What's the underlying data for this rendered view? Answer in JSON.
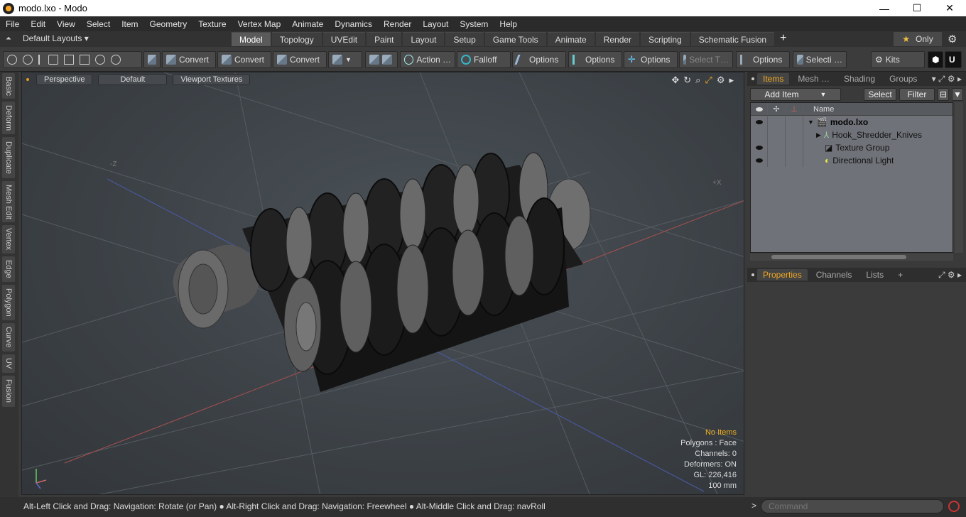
{
  "window": {
    "title": "modo.lxo - Modo",
    "min": "—",
    "max": "☐",
    "close": "✕"
  },
  "menu": [
    "File",
    "Edit",
    "View",
    "Select",
    "Item",
    "Geometry",
    "Texture",
    "Vertex Map",
    "Animate",
    "Dynamics",
    "Render",
    "Layout",
    "System",
    "Help"
  ],
  "layouts": {
    "label": "Default Layouts ▾"
  },
  "tabs": [
    "Model",
    "Topology",
    "UVEdit",
    "Paint",
    "Layout",
    "Setup",
    "Game Tools",
    "Animate",
    "Render",
    "Scripting",
    "Schematic Fusion"
  ],
  "active_tab": "Model",
  "only_label": "Only",
  "toolbar": {
    "convert1": "Convert",
    "convert2": "Convert",
    "convert3": "Convert",
    "action": "Action …",
    "falloff": "Falloff",
    "options1": "Options",
    "options2": "Options",
    "options3": "Options",
    "select_t": "Select T…",
    "options4": "Options",
    "selecti": "Selecti …",
    "kits": "Kits"
  },
  "left_tabs": [
    "Basic",
    "Deform",
    "Duplicate",
    "Mesh Edit",
    "Vertex",
    "Edge",
    "Polygon",
    "Curve",
    "UV",
    "Fusion"
  ],
  "viewport": {
    "view": "Perspective",
    "shading": "Default",
    "textures": "Viewport Textures",
    "axis_neg_z": "-Z",
    "axis_pos_x": "+X",
    "stats": {
      "no_items": "No Items",
      "polygons": "Polygons : Face",
      "channels": "Channels: 0",
      "deformers": "Deformers: ON",
      "gl": "GL: 226,416",
      "scale": "100 mm"
    }
  },
  "status_hint": "Alt-Left Click and Drag: Navigation: Rotate (or Pan) ● Alt-Right Click and Drag: Navigation: Freewheel ● Alt-Middle Click and Drag: navRoll",
  "command_placeholder": "Command",
  "items_panel": {
    "tabs": [
      "Items",
      "Mesh …",
      "Shading",
      "Groups"
    ],
    "add_item": "Add Item",
    "select": "Select",
    "filter": "Filter",
    "name_header": "Name",
    "rows": [
      {
        "name": "modo.lxo",
        "visible": true
      },
      {
        "name": "Hook_Shredder_Knives",
        "visible": false
      },
      {
        "name": "Texture Group",
        "visible": true
      },
      {
        "name": "Directional Light",
        "visible": true
      }
    ]
  },
  "props_panel": {
    "tabs": [
      "Properties",
      "Channels",
      "Lists"
    ]
  },
  "colors": {
    "accent": "#f0a820",
    "viewport_bg": "#3c4146"
  }
}
